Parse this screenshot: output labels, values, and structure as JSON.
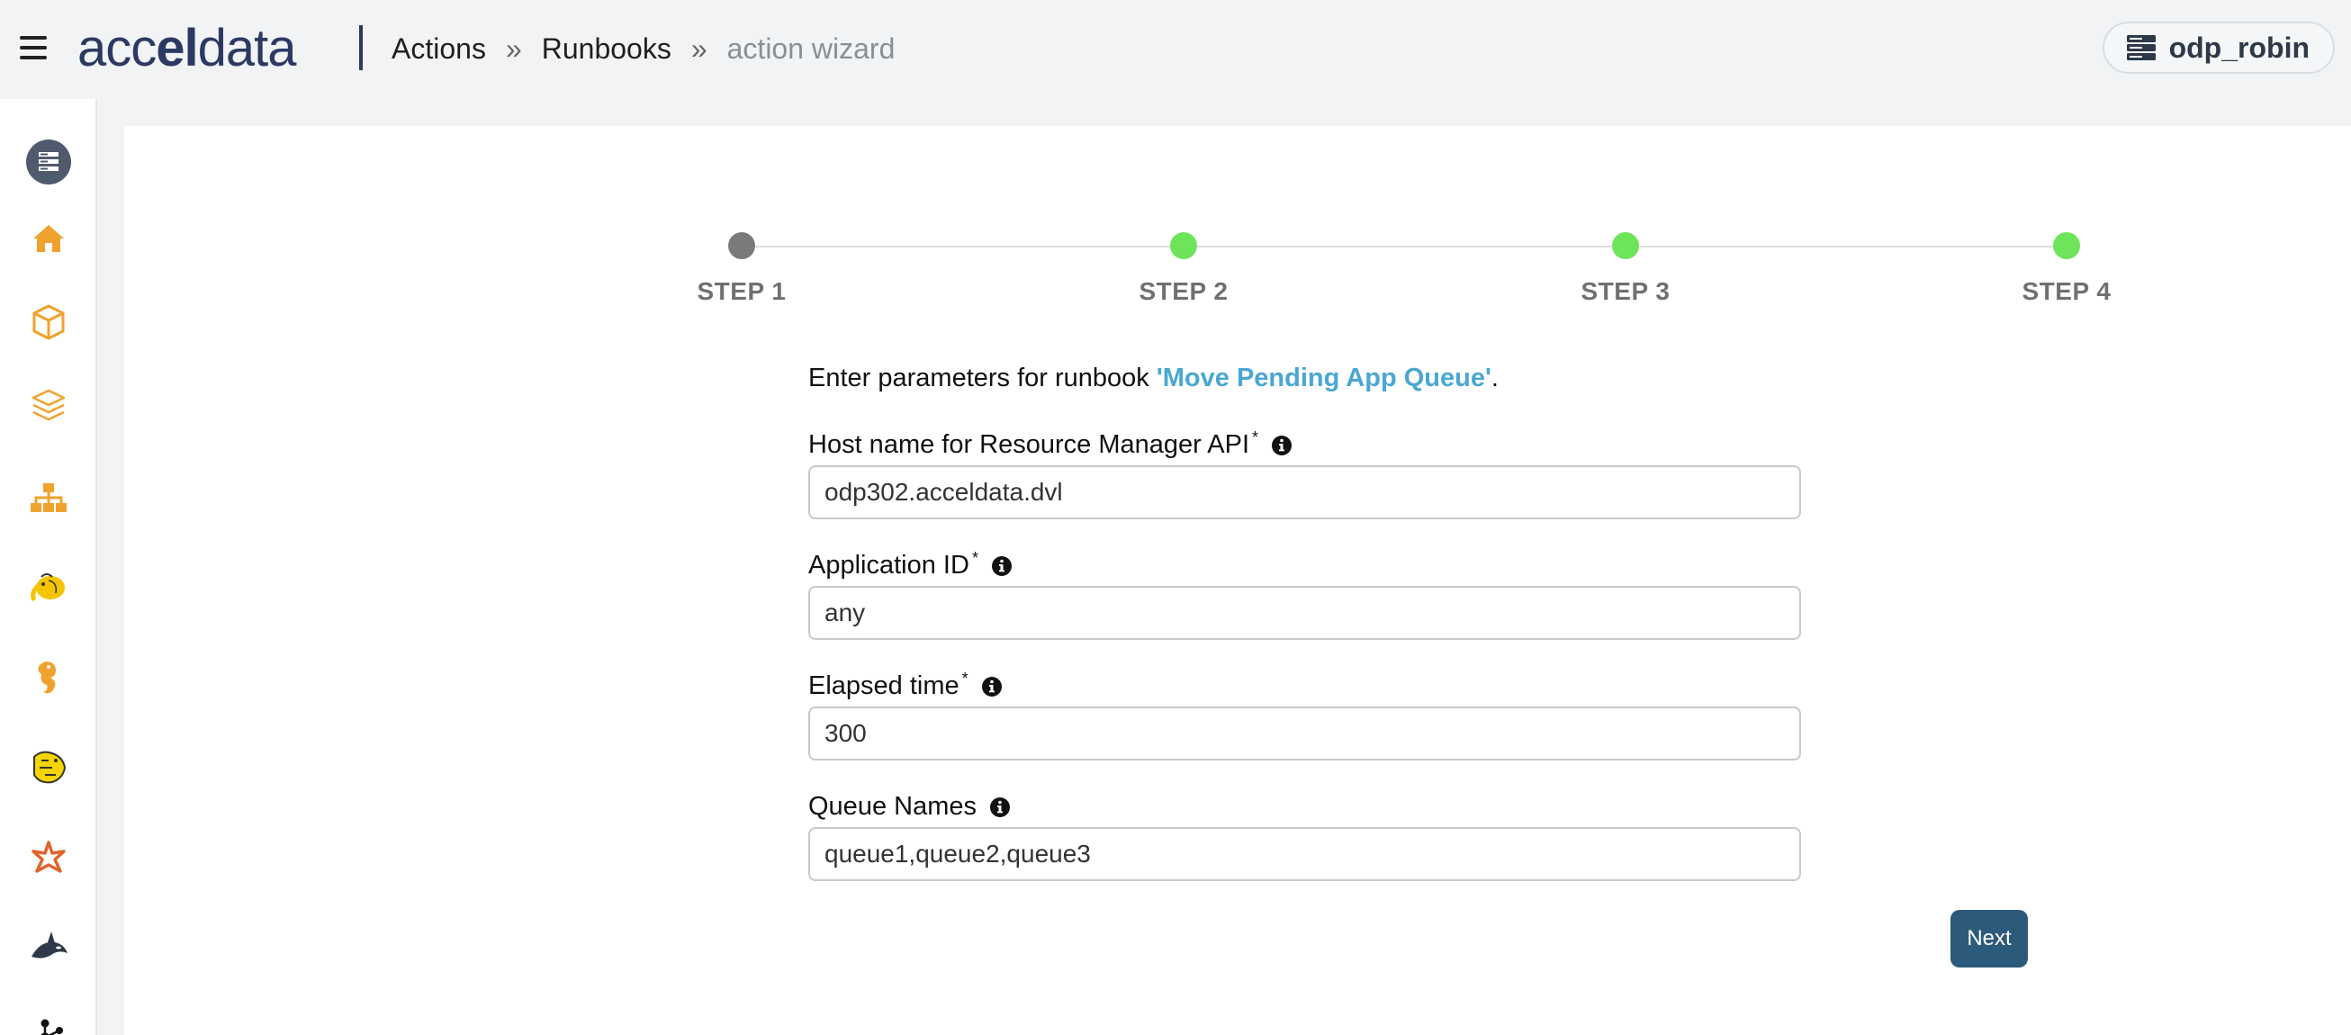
{
  "header": {
    "logo_text": "acceldata",
    "breadcrumbs": [
      {
        "label": "Actions"
      },
      {
        "label": "Runbooks"
      },
      {
        "label": "action wizard"
      }
    ],
    "separator": "»",
    "cluster_name": "odp_robin"
  },
  "sidebar": {
    "items": [
      {
        "icon": "cluster-icon"
      },
      {
        "icon": "home-icon"
      },
      {
        "icon": "cube-icon"
      },
      {
        "icon": "layers-icon"
      },
      {
        "icon": "hierarchy-icon"
      },
      {
        "icon": "hadoop-elephant-icon"
      },
      {
        "icon": "seahorse-icon"
      },
      {
        "icon": "hive-icon"
      },
      {
        "icon": "spark-star-icon"
      },
      {
        "icon": "orca-icon"
      },
      {
        "icon": "kafka-icon"
      }
    ]
  },
  "wizard": {
    "steps": [
      {
        "label": "STEP 1",
        "state": "current",
        "color": "#7a7a7a"
      },
      {
        "label": "STEP 2",
        "state": "complete",
        "color": "#6ee45a"
      },
      {
        "label": "STEP 3",
        "state": "complete",
        "color": "#6ee45a"
      },
      {
        "label": "STEP 4",
        "state": "complete",
        "color": "#6ee45a"
      }
    ],
    "intro_prefix": "Enter parameters for runbook ",
    "runbook_name": "'Move Pending App Queue'",
    "intro_suffix": ".",
    "fields": [
      {
        "label": "Host name for Resource Manager API",
        "required": "*",
        "value": "odp302.acceldata.dvl"
      },
      {
        "label": "Application ID",
        "required": "*",
        "value": "any"
      },
      {
        "label": "Elapsed time",
        "required": "*",
        "value": "300"
      },
      {
        "label": "Queue Names",
        "required": "",
        "value": "queue1,queue2,queue3"
      }
    ],
    "next_label": "Next"
  },
  "colors": {
    "brand": "#2c3a63",
    "accent_link": "#4aa7d2",
    "button": "#2b5a7a",
    "sidebar_icon": "#f0a22e"
  }
}
